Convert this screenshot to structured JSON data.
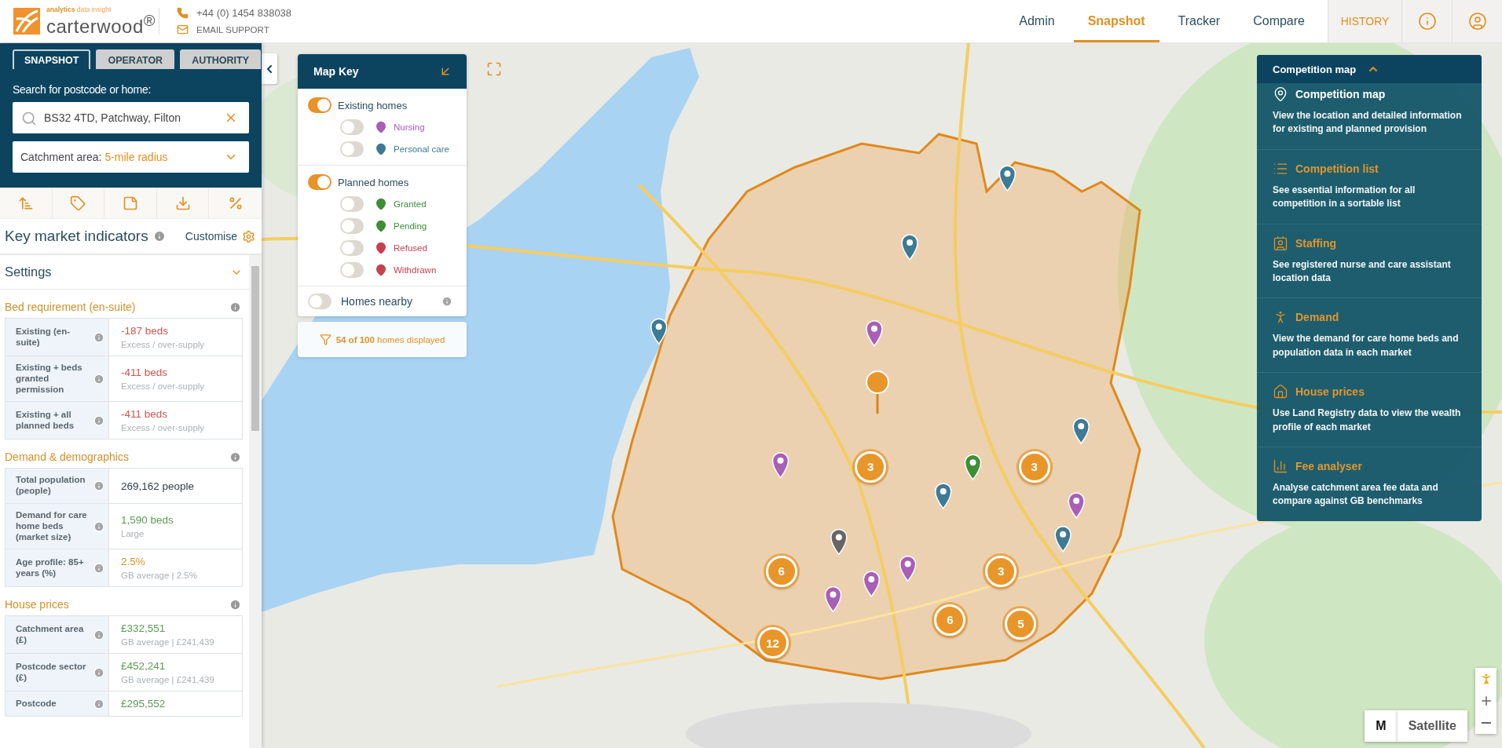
{
  "header": {
    "logo": {
      "tagline_strong": "analytics",
      "tagline_light": "data insight",
      "name": "carterwood$^{®}$"
    },
    "phone": "+44 (0) 1454 838038",
    "email": "EMAIL SUPPORT",
    "nav": [
      {
        "label": "Admin",
        "selected": false
      },
      {
        "label": "Snapshot",
        "selected": true
      },
      {
        "label": "Tracker",
        "selected": false
      },
      {
        "label": "Compare",
        "selected": false
      }
    ],
    "history": "HISTORY"
  },
  "sidebar": {
    "tabs": [
      {
        "label": "SNAPSHOT",
        "selected": true
      },
      {
        "label": "OPERATOR",
        "selected": false
      },
      {
        "label": "AUTHORITY",
        "selected": false
      }
    ],
    "search_label": "Search for postcode or home:",
    "search_value": "BS32 4TD, Patchway, Filton",
    "catchment_label": "Catchment area:",
    "catchment_value": "5-mile radius",
    "indicators_title": "Key market indicators",
    "customise": "Customise",
    "settings": "Settings",
    "sections": [
      {
        "title": "Bed requirement (en-suite)",
        "rows": [
          {
            "label": "Existing (en-suite)",
            "value": "-187 beds",
            "note": "Excess / over-supply",
            "color": "#cf5550"
          },
          {
            "label": "Existing + beds granted permission",
            "value": "-411 beds",
            "note": "Excess / over-supply",
            "color": "#cf5550"
          },
          {
            "label": "Existing + all planned beds",
            "value": "-411 beds",
            "note": "Excess / over-supply",
            "color": "#cf5550"
          }
        ]
      },
      {
        "title": "Demand & demographics",
        "rows": [
          {
            "label": "Total population (people)",
            "value": "269,162 people",
            "color": "#2f3d48"
          },
          {
            "label": "Demand for care home beds (market size)",
            "value": "1,590 beds",
            "note": "Large",
            "color": "#5b9a55"
          },
          {
            "label": "Age profile: 85+ years (%)",
            "value": "2.5%",
            "note": "GB average | 2.5%",
            "color": "#d4902a"
          }
        ]
      },
      {
        "title": "House prices",
        "rows": [
          {
            "label": "Catchment area (£)",
            "value": "£332,551",
            "note": "GB average | £241,439",
            "color": "#5b9a55"
          },
          {
            "label": "Postcode sector (£)",
            "value": "£452,241",
            "note": "GB average | £241,439",
            "color": "#5b9a55"
          },
          {
            "label": "Postcode",
            "value": "£295,552",
            "color": "#5b9a55"
          }
        ]
      }
    ]
  },
  "map_key": {
    "title": "Map Key",
    "groups": [
      {
        "label": "Existing homes",
        "on": true,
        "items": [
          {
            "label": "Nursing",
            "on": false,
            "color": "#a85fb5"
          },
          {
            "label": "Personal care",
            "on": false,
            "color": "#3d7a94"
          }
        ]
      },
      {
        "label": "Planned homes",
        "on": true,
        "items": [
          {
            "label": "Granted",
            "on": false,
            "color": "#3e8e37"
          },
          {
            "label": "Pending",
            "on": false,
            "color": "#3e8e37"
          },
          {
            "label": "Refused",
            "on": false,
            "color": "#c8404e"
          },
          {
            "label": "Withdrawn",
            "on": false,
            "color": "#c8404e"
          }
        ]
      }
    ],
    "nearby": {
      "label": "Homes nearby",
      "on": false
    },
    "filter": "**54 of 100** homes displayed"
  },
  "competition_panel": {
    "title": "Competition map",
    "expanded": true,
    "items": [
      {
        "kind": "map",
        "title": "Competition map",
        "description": "View the location and detailed information for existing and planned provision",
        "selected": true
      },
      {
        "kind": "list",
        "title": "Competition list",
        "description": "See essential information for all competition in a sortable list",
        "selected": false
      },
      {
        "kind": "staffing",
        "title": "Staffing",
        "description": "See registered nurse and care assistant location data",
        "selected": false
      },
      {
        "kind": "demand",
        "title": "Demand",
        "description": "View the demand for care home beds and population data in each market",
        "selected": false
      },
      {
        "kind": "house",
        "title": "House prices",
        "description": "Use Land Registry data to view the wealth profile of each market",
        "selected": false
      },
      {
        "kind": "fee",
        "title": "Fee analyser",
        "description": "Analyse catchment area fee data and compare against GB benchmarks",
        "selected": false
      }
    ]
  },
  "map": {
    "clusters": [
      "3",
      "3",
      "6",
      "3",
      "6",
      "5",
      "12"
    ],
    "map_types": [
      {
        "label": "M",
        "selected": true
      },
      {
        "label": "Satellite",
        "selected": false
      }
    ]
  }
}
